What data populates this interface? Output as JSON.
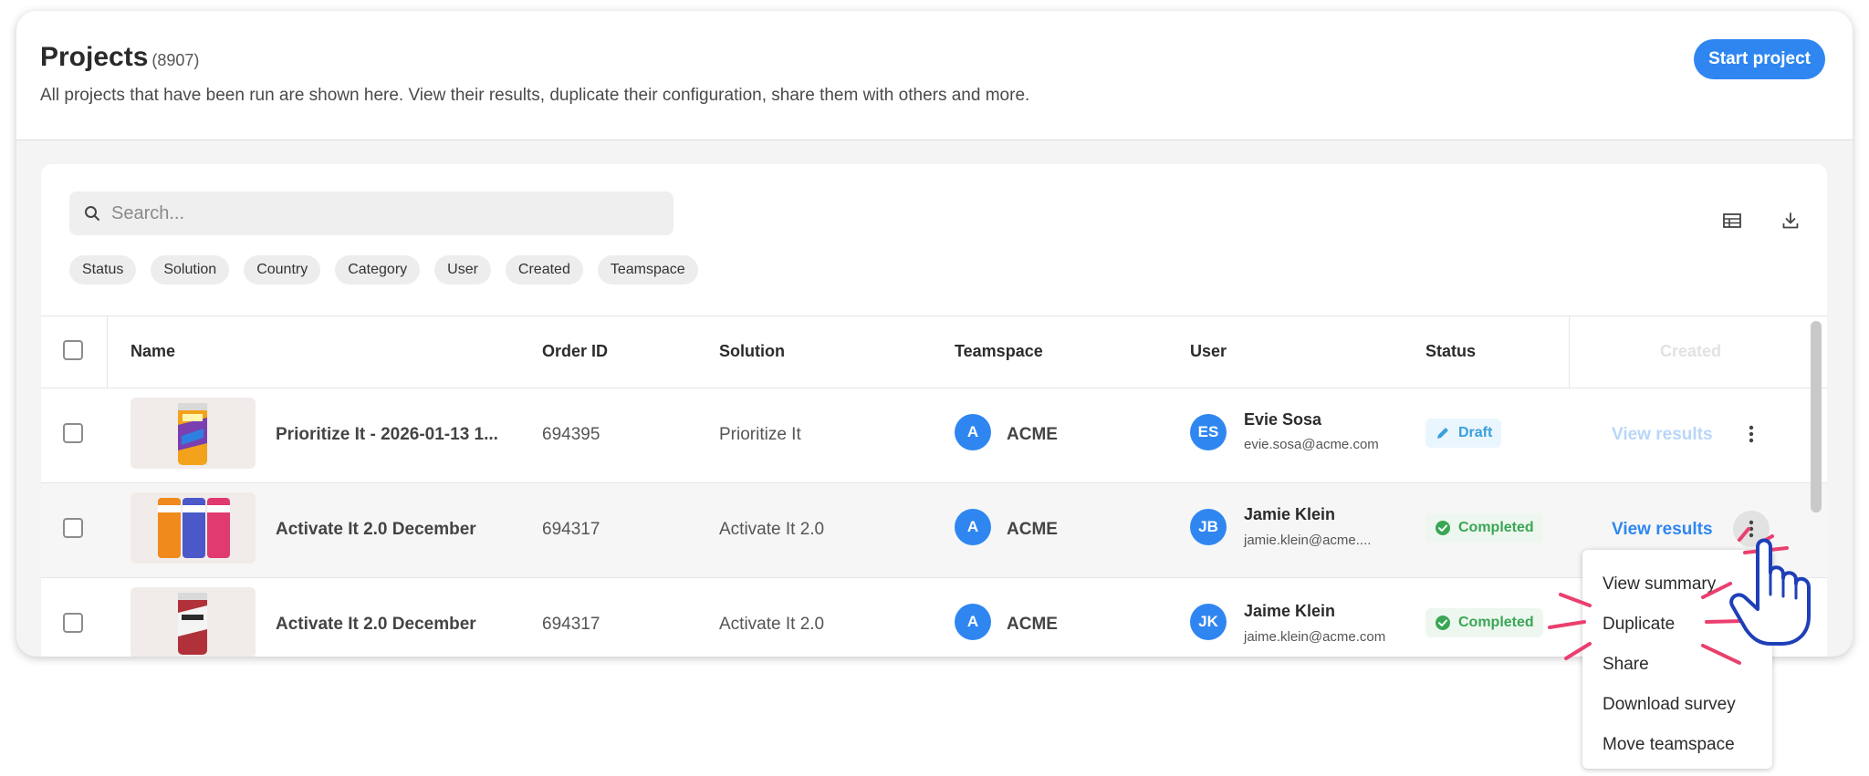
{
  "header": {
    "title": "Projects",
    "count": "(8907)",
    "subtitle": "All projects that have been run are shown here. View their results, duplicate their configuration, share them with others and more.",
    "start_button": "Start project"
  },
  "search": {
    "placeholder": "Search..."
  },
  "filters": [
    "Status",
    "Solution",
    "Country",
    "Category",
    "User",
    "Created",
    "Teamspace"
  ],
  "columns": {
    "name": "Name",
    "order_id": "Order ID",
    "solution": "Solution",
    "teamspace": "Teamspace",
    "user": "User",
    "status": "Status",
    "created": "Created"
  },
  "rows": [
    {
      "name": "Prioritize It - 2026-01-13 1...",
      "order_id": "694395",
      "solution": "Prioritize It",
      "team_initial": "A",
      "team": "ACME",
      "user_initials": "ES",
      "user_name": "Evie Sosa",
      "user_email": "evie.sosa@acme.com",
      "status": "Draft",
      "action": "View results"
    },
    {
      "name": "Activate It 2.0 December",
      "order_id": "694317",
      "solution": "Activate It 2.0",
      "team_initial": "A",
      "team": "ACME",
      "user_initials": "JB",
      "user_name": "Jamie Klein",
      "user_email": "jamie.klein@acme....",
      "status": "Completed",
      "action": "View results"
    },
    {
      "name": "Activate It 2.0 December",
      "order_id": "694317",
      "solution": "Activate It 2.0",
      "team_initial": "A",
      "team": "ACME",
      "user_initials": "JK",
      "user_name": "Jaime Klein",
      "user_email": "jaime.klein@acme.com",
      "status": "Completed",
      "action": ""
    }
  ],
  "menu": [
    "View summary",
    "Duplicate",
    "Share",
    "Download survey",
    "Move teamspace"
  ],
  "colors": {
    "accent": "#2f86f0",
    "draft": "#3a9fdc",
    "completed": "#3aa655",
    "highlight": "#ea3f6e",
    "hand": "#1f3fb8"
  },
  "icons": {
    "search": "search-icon",
    "table_view": "table-view-icon",
    "download": "download-icon",
    "kebab": "more-vertical-icon",
    "pencil": "pencil-icon",
    "check": "check-circle-icon",
    "cursor": "hand-pointer-icon"
  }
}
